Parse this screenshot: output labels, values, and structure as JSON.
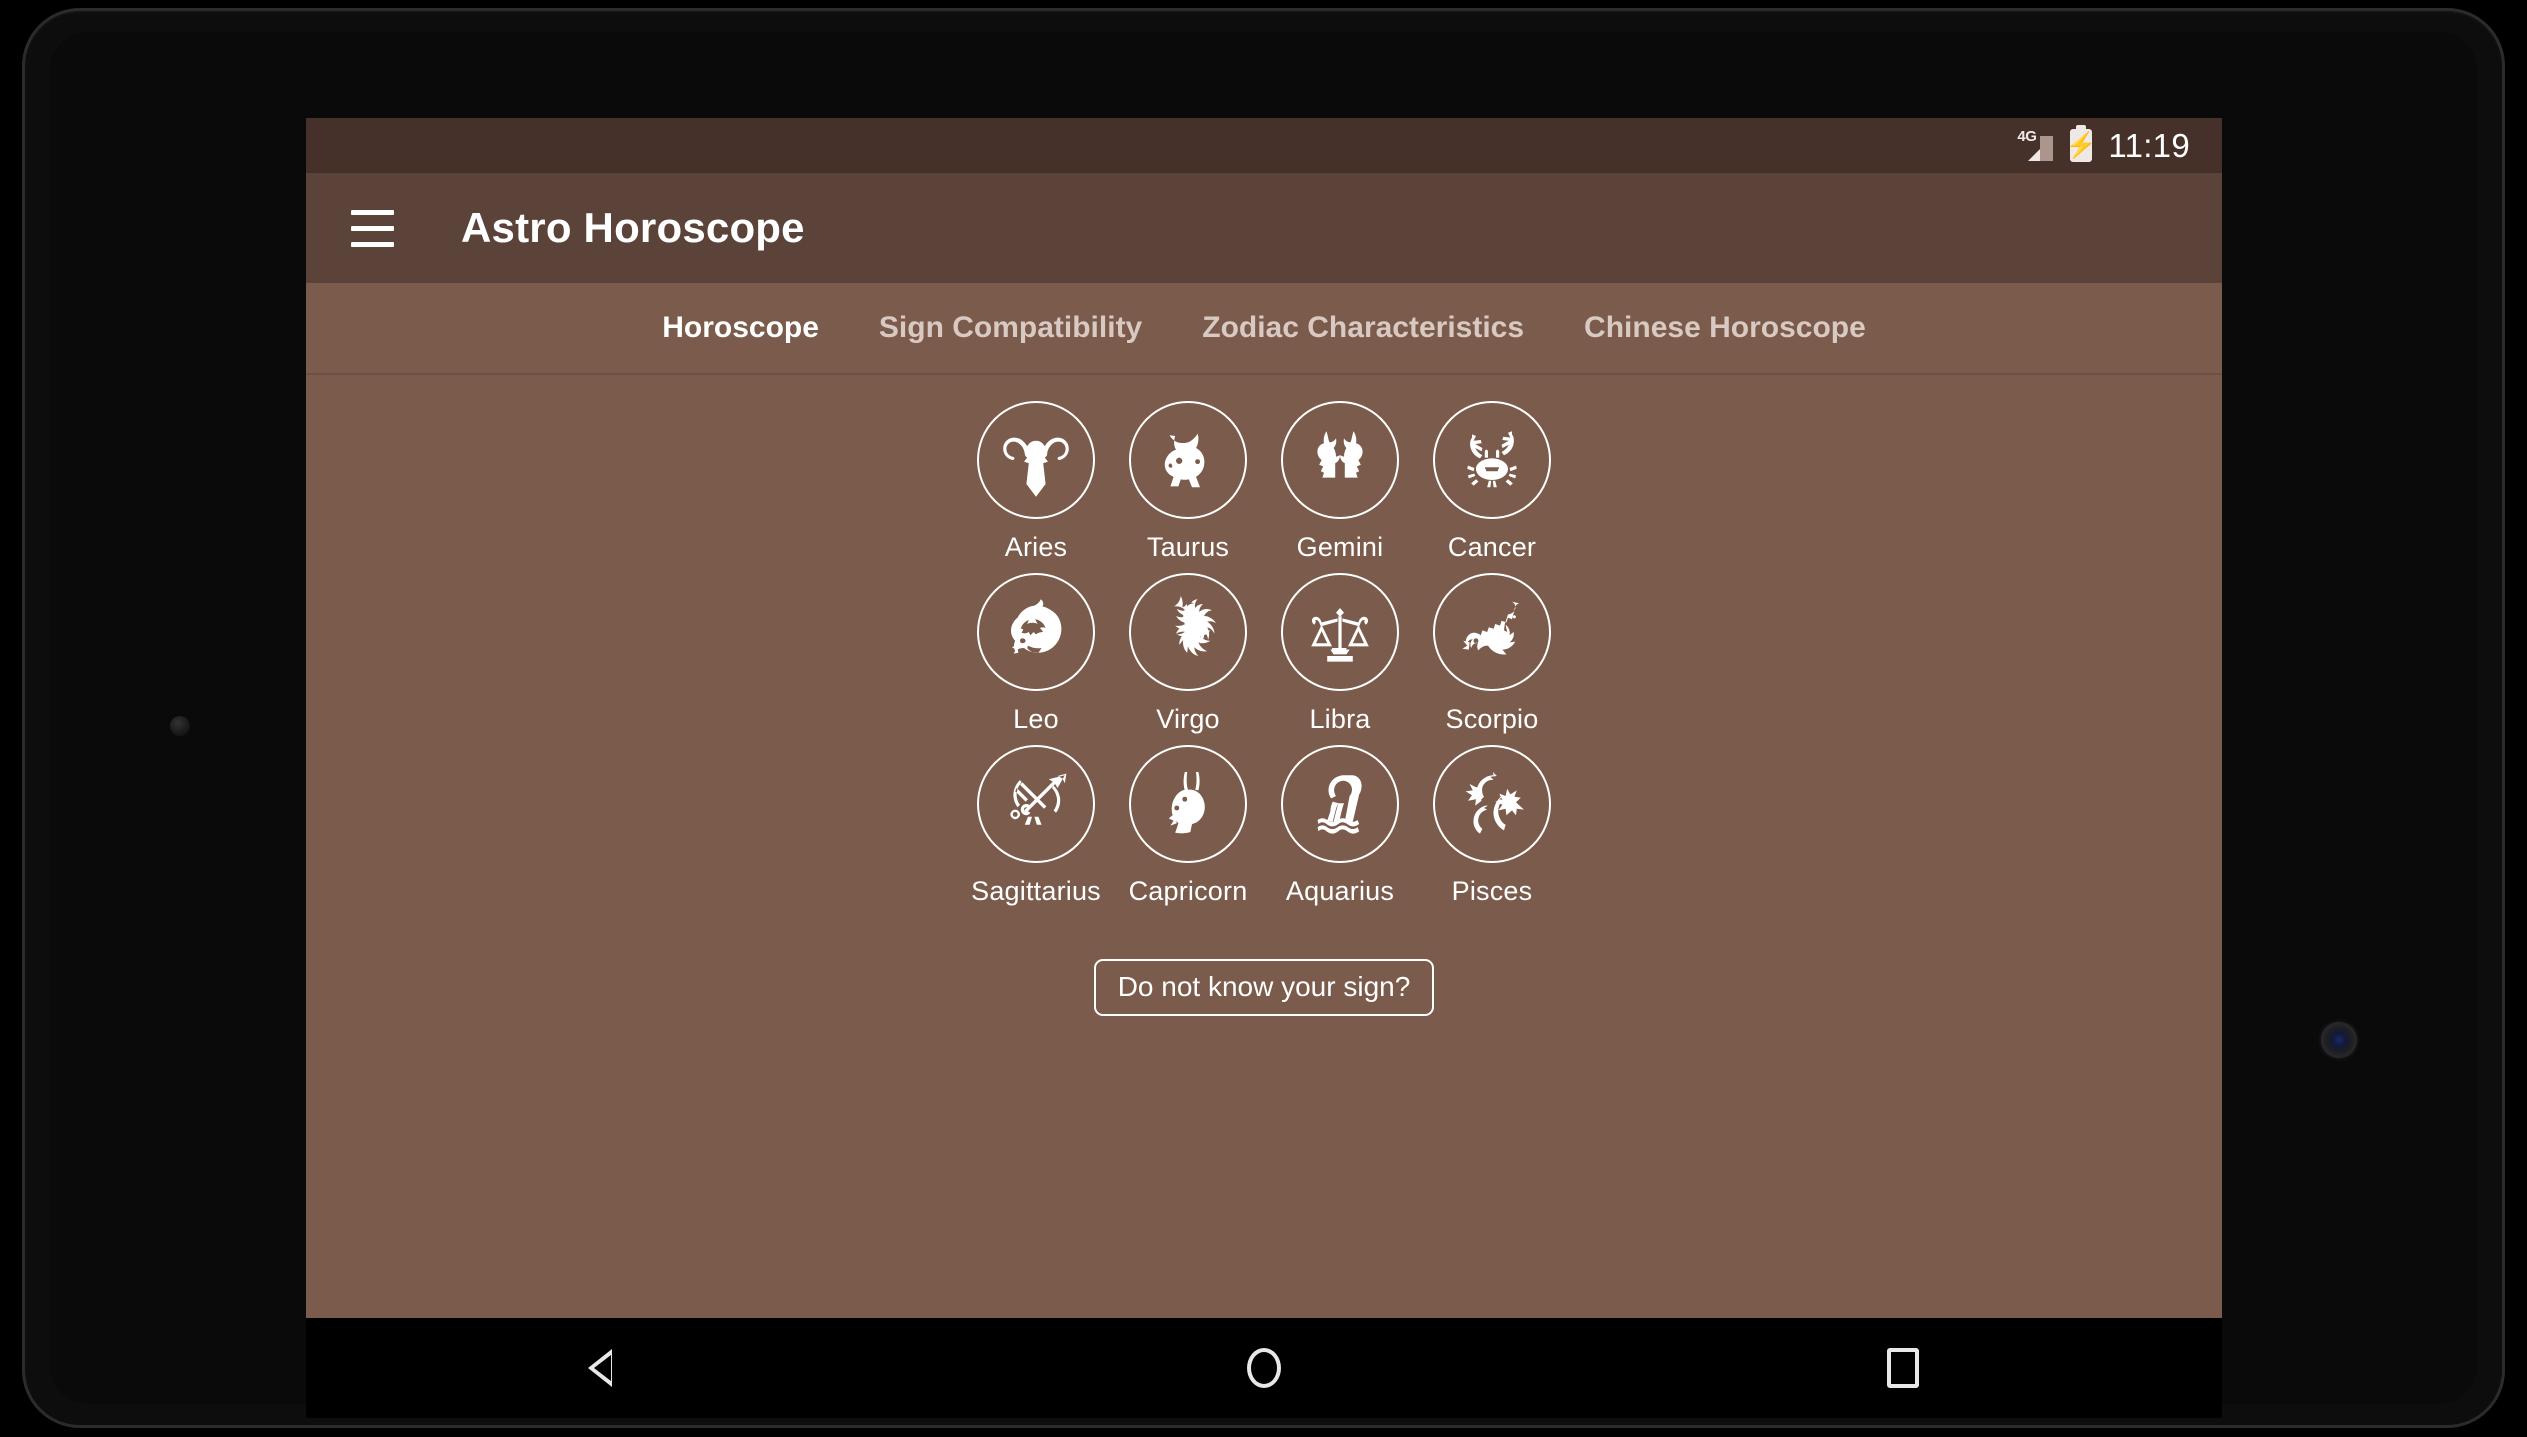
{
  "status_bar": {
    "network_label": "4G",
    "time": "11:19",
    "battery_icon": "battery-charging-icon",
    "signal_icon": "signal-4g-icon"
  },
  "app_bar": {
    "menu_icon": "hamburger-menu-icon",
    "title": "Astro Horoscope"
  },
  "tabs": [
    {
      "label": "Horoscope",
      "active": true
    },
    {
      "label": "Sign Compatibility",
      "active": false
    },
    {
      "label": "Zodiac Characteristics",
      "active": false
    },
    {
      "label": "Chinese Horoscope",
      "active": false
    }
  ],
  "signs": [
    {
      "label": "Aries",
      "icon": "aries-ram-icon"
    },
    {
      "label": "Taurus",
      "icon": "taurus-bull-icon"
    },
    {
      "label": "Gemini",
      "icon": "gemini-twins-icon"
    },
    {
      "label": "Cancer",
      "icon": "cancer-crab-icon"
    },
    {
      "label": "Leo",
      "icon": "leo-lion-icon"
    },
    {
      "label": "Virgo",
      "icon": "virgo-maiden-icon"
    },
    {
      "label": "Libra",
      "icon": "libra-scales-icon"
    },
    {
      "label": "Scorpio",
      "icon": "scorpio-scorpion-icon"
    },
    {
      "label": "Sagittarius",
      "icon": "sagittarius-archer-icon"
    },
    {
      "label": "Capricorn",
      "icon": "capricorn-goat-icon"
    },
    {
      "label": "Aquarius",
      "icon": "aquarius-waterbearer-icon"
    },
    {
      "label": "Pisces",
      "icon": "pisces-fish-icon"
    }
  ],
  "footer": {
    "unknown_sign_label": "Do not know your sign?"
  },
  "navigation_bar": {
    "back_icon": "back-triangle-icon",
    "home_icon": "home-circle-icon",
    "recents_icon": "recents-square-icon"
  },
  "colors": {
    "status_bar": "#45302a",
    "app_bar": "#5b4339",
    "content": "#7b5b4b",
    "accent_text": "#ffffff",
    "inactive_tab_text": "#d8c9c2",
    "nav_bar": "#000000"
  }
}
